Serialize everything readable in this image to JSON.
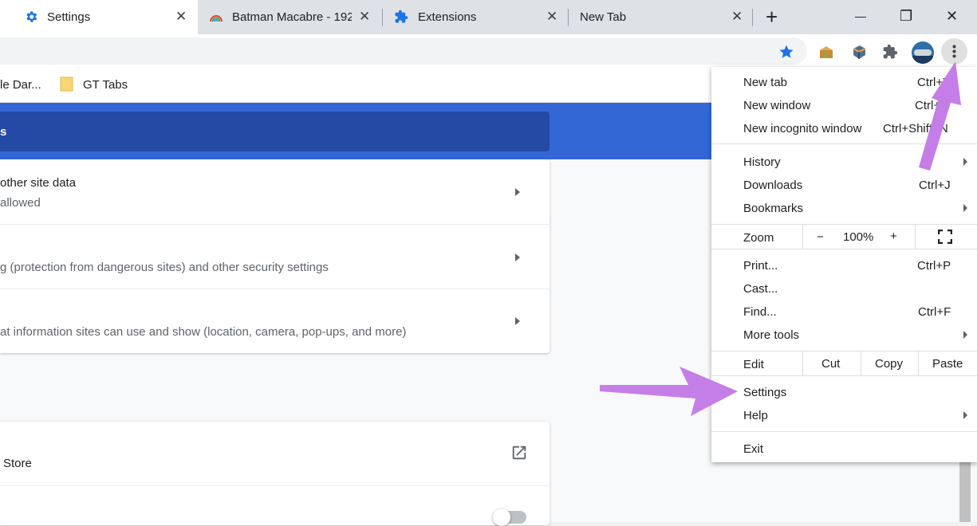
{
  "tabs": [
    {
      "title": "Settings",
      "icon": "gear-icon",
      "close": "✕"
    },
    {
      "title": "Batman Macabre - 192",
      "icon": "rainbow-favicon-icon",
      "close": "✕"
    },
    {
      "title": "Extensions",
      "icon": "puzzle-icon",
      "close": "✕"
    },
    {
      "title": "New Tab",
      "icon": "",
      "close": "✕"
    }
  ],
  "new_tab_symbol": "+",
  "window_controls": {
    "minimize": "—",
    "restore": "❐",
    "close": "✕"
  },
  "bookmarks": [
    {
      "label": "le Dar..."
    },
    {
      "label": "GT Tabs",
      "icon": "folder-icon"
    }
  ],
  "settings": {
    "search_partial": "s",
    "rows": [
      {
        "title": "other site data",
        "subtitle": "allowed"
      },
      {
        "title": "",
        "subtitle": "g (protection from dangerous sites) and other security settings"
      },
      {
        "title": "",
        "subtitle": "at information sites can use and show (location, camera, pop-ups, and more)"
      }
    ],
    "store_row": {
      "label": "Store"
    }
  },
  "menu": {
    "group1": [
      {
        "label": "New tab",
        "shortcut": "Ctrl+T"
      },
      {
        "label": "New window",
        "shortcut": "Ctrl+N"
      },
      {
        "label": "New incognito window",
        "shortcut": "Ctrl+Shift+N"
      }
    ],
    "group2": [
      {
        "label": "History",
        "submenu": true
      },
      {
        "label": "Downloads",
        "shortcut": "Ctrl+J"
      },
      {
        "label": "Bookmarks",
        "submenu": true
      }
    ],
    "zoom": {
      "label": "Zoom",
      "minus": "−",
      "value": "100%",
      "plus": "+"
    },
    "group3": [
      {
        "label": "Print...",
        "shortcut": "Ctrl+P"
      },
      {
        "label": "Cast..."
      },
      {
        "label": "Find...",
        "shortcut": "Ctrl+F"
      },
      {
        "label": "More tools",
        "submenu": true
      }
    ],
    "edit": {
      "label": "Edit",
      "cut": "Cut",
      "copy": "Copy",
      "paste": "Paste"
    },
    "group4": [
      {
        "label": "Settings"
      },
      {
        "label": "Help",
        "submenu": true
      }
    ],
    "exit": "Exit"
  },
  "colors": {
    "accent_blue": "#1a73e8",
    "header_blue": "#3367d6",
    "search_blue": "#254aa5",
    "annotation_arrow": "#c57ee8"
  }
}
